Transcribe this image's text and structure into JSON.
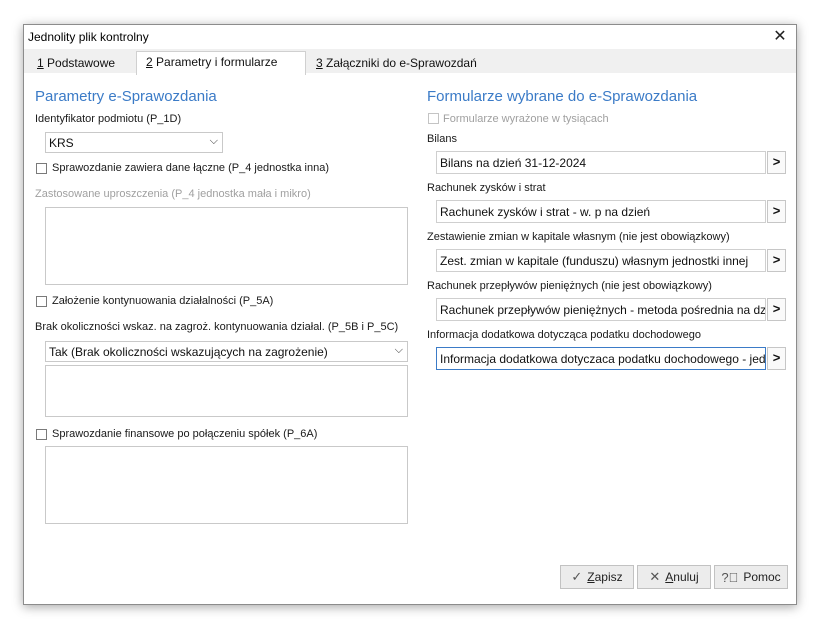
{
  "window": {
    "title": "Jednolity plik kontrolny",
    "close_glyph": "✕"
  },
  "tabs": [
    {
      "key": "1",
      "rest": " Podstawowe"
    },
    {
      "key": "2",
      "rest": " Parametry i formularze"
    },
    {
      "key": "3",
      "rest": " Załączniki do e-Sprawozdań"
    }
  ],
  "left": {
    "heading": "Parametry e-Sprawozdania",
    "id_label": "Identyfikator podmiotu (P_1D)",
    "id_value": "KRS",
    "cb_joint": "Sprawozdanie zawiera dane łączne (P_4 jednostka inna)",
    "simpl_label": "Zastosowane uproszczenia (P_4  jednostka mała i mikro)",
    "cb_continuation": "Założenie kontynuowania działalności (P_5A)",
    "threat_label": "Brak okoliczności wskaz. na zagroż. kontynuowania działal. (P_5B i P_5C)",
    "threat_value": "Tak (Brak okoliczności wskazujących na zagrożenie)",
    "cb_merger": "Sprawozdanie finansowe po połączeniu spółek (P_6A)"
  },
  "right": {
    "heading": "Formularze wybrane do e-Sprawozdania",
    "cb_thousands": "Formularze wyrażone w tysiącach",
    "forms": [
      {
        "label": "Bilans",
        "value": "Bilans na dzień 31-12-2024"
      },
      {
        "label": "Rachunek zysków i strat",
        "value": "Rachunek zysków i strat - w. p na dzień"
      },
      {
        "label": "Zestawienie zmian w kapitale własnym (nie jest obowiązkowy)",
        "value": "Zest. zmian w kapitale (funduszu) własnym jednostki innej"
      },
      {
        "label": "Rachunek przepływów pieniężnych (nie jest obowiązkowy)",
        "value": "Rachunek przepływów pieniężnych - metoda pośrednia na dzień"
      },
      {
        "label": "Informacja dodatkowa dotycząca podatku dochodowego",
        "value": "Informacja dodatkowa dotyczaca podatku dochodowego - jednostki"
      }
    ],
    "arrow_glyph": ">"
  },
  "buttons": {
    "save_key": "Z",
    "save_rest": "apisz",
    "cancel_key": "A",
    "cancel_rest": "nuluj",
    "help": "Pomoc"
  },
  "colors": {
    "accent": "#3b7bc7",
    "tab_bg": "#f0f0f0",
    "button_bg": "#ececec"
  }
}
